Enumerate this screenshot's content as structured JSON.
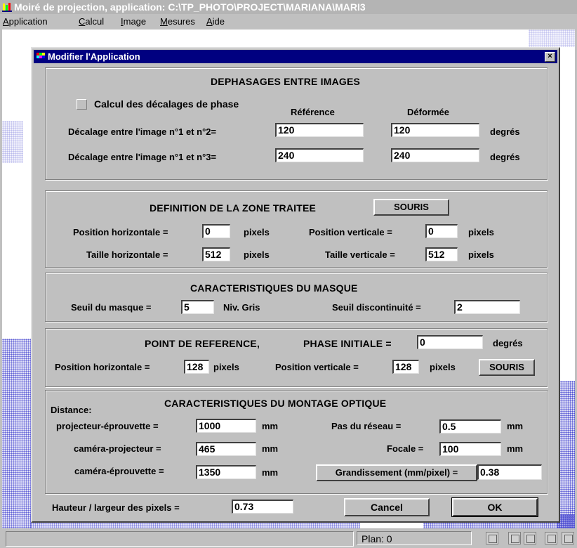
{
  "window": {
    "title": "Moiré de projection, application: C:\\TP_PHOTO\\PROJECT\\MARIANA\\MARI3"
  },
  "menu": [
    "Application",
    "Calcul",
    "Image",
    "Mesures",
    "Aide"
  ],
  "dialog": {
    "title": "Modifier l'Application",
    "close_glyph": "×",
    "phase": {
      "header": "DEPHASAGES ENTRE IMAGES",
      "checkbox_label": "Calcul des décalages de phase",
      "col_reference": "Référence",
      "col_deformee": "Déformée",
      "row1_label": "Décalage entre l'image n°1 et n°2=",
      "row1_ref": "120",
      "row1_def": "120",
      "row2_label": "Décalage entre l'image n°1 et n°3=",
      "row2_ref": "240",
      "row2_def": "240",
      "unit": "degrés"
    },
    "zone": {
      "header": "DEFINITION DE LA ZONE TRAITEE",
      "souris_label": "SOURIS",
      "pos_h_label": "Position horizontale =",
      "pos_h_value": "0",
      "pos_v_label": "Position verticale =",
      "pos_v_value": "0",
      "taille_h_label": "Taille horizontale =",
      "taille_h_value": "512",
      "taille_v_label": "Taille verticale =",
      "taille_v_value": "512",
      "unit": "pixels"
    },
    "masque": {
      "header": "CARACTERISTIQUES DU MASQUE",
      "seuil_label": "Seuil du masque =",
      "seuil_value": "5",
      "seuil_unit": "Niv. Gris",
      "discont_label": "Seuil discontinuité =",
      "discont_value": "2"
    },
    "reference": {
      "header": "POINT DE REFERENCE,",
      "phase_label": "PHASE INITIALE =",
      "phase_value": "0",
      "phase_unit": "degrés",
      "pos_h_label": "Position horizontale =",
      "pos_h_value": "128",
      "pos_v_label": "Position verticale =",
      "pos_v_value": "128",
      "unit": "pixels",
      "souris_label": "SOURIS"
    },
    "optique": {
      "header": "CARACTERISTIQUES DU MONTAGE OPTIQUE",
      "distance_label": "Distance:",
      "proj_epr_label": "projecteur-éprouvette =",
      "proj_epr_value": "1000",
      "cam_proj_label": "caméra-projecteur =",
      "cam_proj_value": "465",
      "cam_epr_label": "caméra-éprouvette =",
      "cam_epr_value": "1350",
      "mm": "mm",
      "pas_label": "Pas du réseau =",
      "pas_value": "0.5",
      "focale_label": "Focale =",
      "focale_value": "100",
      "grand_label": "Grandissement (mm/pixel) =",
      "grand_value": "0.38"
    },
    "footer": {
      "ratio_label": "Hauteur / largeur des pixels =",
      "ratio_value": "0.73",
      "cancel_label": "Cancel",
      "ok_label": "OK"
    }
  },
  "status": {
    "plan": "Plan: 0"
  }
}
